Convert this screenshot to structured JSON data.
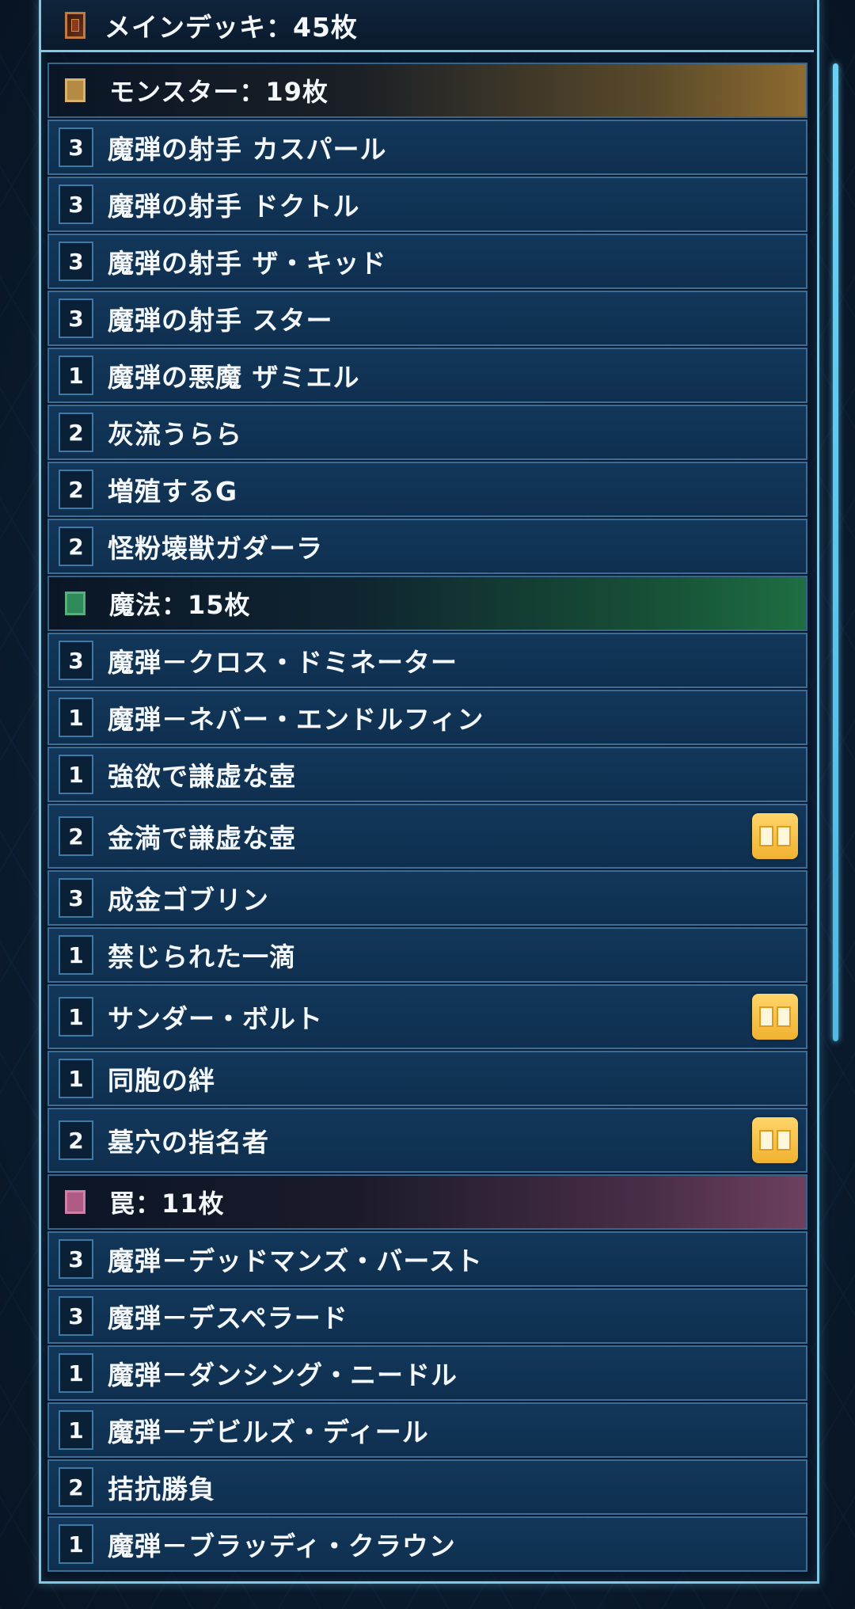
{
  "header": {
    "icon": "deck-card-icon",
    "title": "メインデッキ：45枚"
  },
  "sections": {
    "monster": {
      "label": "モンスター：19枚",
      "color": "#b48a44"
    },
    "spell": {
      "label": "魔法：15枚",
      "color": "#2f8a5a"
    },
    "trap": {
      "label": "罠：11枚",
      "color": "#b05a86"
    }
  },
  "monsters": [
    {
      "count": "3",
      "name": "魔弾の射手 カスパール"
    },
    {
      "count": "3",
      "name": "魔弾の射手 ドクトル"
    },
    {
      "count": "3",
      "name": "魔弾の射手 ザ・キッド"
    },
    {
      "count": "3",
      "name": "魔弾の射手 スター"
    },
    {
      "count": "1",
      "name": "魔弾の悪魔 ザミエル"
    },
    {
      "count": "2",
      "name": "灰流うらら"
    },
    {
      "count": "2",
      "name": "増殖するG"
    },
    {
      "count": "2",
      "name": "怪粉壊獣ガダーラ"
    }
  ],
  "spells": [
    {
      "count": "3",
      "name": "魔弾－クロス・ドミネーター"
    },
    {
      "count": "1",
      "name": "魔弾－ネバー・エンドルフィン"
    },
    {
      "count": "1",
      "name": "強欲で謙虚な壺"
    },
    {
      "count": "2",
      "name": "金満で謙虚な壺",
      "badge": "book-icon"
    },
    {
      "count": "3",
      "name": "成金ゴブリン"
    },
    {
      "count": "1",
      "name": "禁じられた一滴"
    },
    {
      "count": "1",
      "name": "サンダー・ボルト",
      "badge": "book-icon"
    },
    {
      "count": "1",
      "name": "同胞の絆"
    },
    {
      "count": "2",
      "name": "墓穴の指名者",
      "badge": "book-icon"
    }
  ],
  "traps": [
    {
      "count": "3",
      "name": "魔弾－デッドマンズ・バースト"
    },
    {
      "count": "3",
      "name": "魔弾－デスペラード"
    },
    {
      "count": "1",
      "name": "魔弾－ダンシング・ニードル"
    },
    {
      "count": "1",
      "name": "魔弾－デビルズ・ディール"
    },
    {
      "count": "2",
      "name": "拮抗勝負"
    },
    {
      "count": "1",
      "name": "魔弾－ブラッディ・クラウン"
    }
  ],
  "colors": {
    "frame": "#7fc8e6",
    "row_bg": "#12375a",
    "badge": "#f0b230"
  }
}
